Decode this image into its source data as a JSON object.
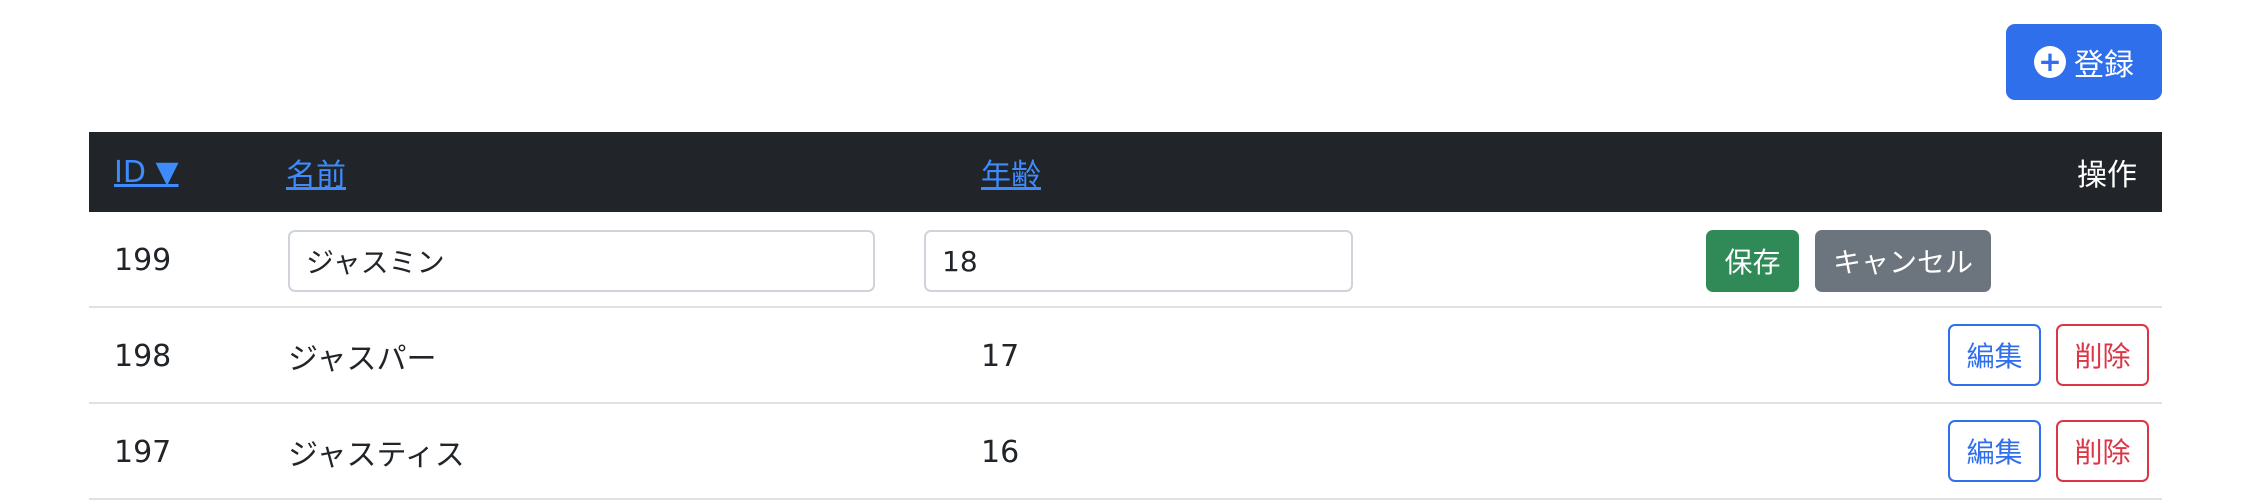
{
  "toolbar": {
    "register_label": "登録",
    "register_icon": "plus-circle-icon"
  },
  "table": {
    "headers": {
      "id": "ID ▼",
      "name": "名前",
      "age": "年齢",
      "ops": "操作"
    },
    "editing_row": {
      "id": "199",
      "name_value": "ジャスミン",
      "age_value": "18",
      "save_label": "保存",
      "cancel_label": "キャンセル"
    },
    "rows": [
      {
        "id": "198",
        "name": "ジャスパー",
        "age": "17",
        "edit_label": "編集",
        "delete_label": "削除"
      },
      {
        "id": "197",
        "name": "ジャスティス",
        "age": "16",
        "edit_label": "編集",
        "delete_label": "削除"
      }
    ]
  },
  "colors": {
    "primary": "#2f6fec",
    "success": "#2f8a57",
    "secondary": "#6c757d",
    "danger": "#dc3545",
    "header_bg": "#212529"
  }
}
